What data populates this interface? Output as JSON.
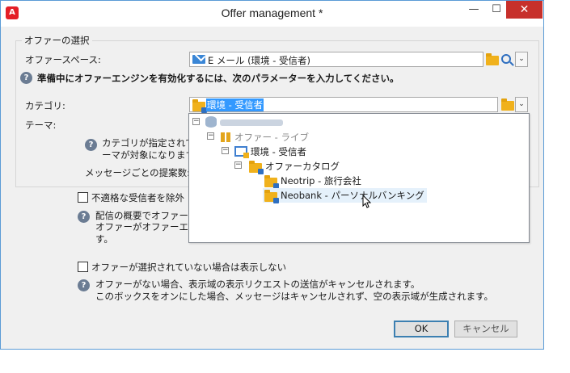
{
  "window": {
    "title": "Offer management *",
    "app_icon_letter": "A",
    "minimize": "—",
    "maximize": "☐",
    "close": "✕"
  },
  "group": {
    "title": "オファーの選択"
  },
  "offer_space": {
    "label": "オファースペース:",
    "value": "E メール (環境 - 受信者)"
  },
  "warning": "準備中にオファーエンジンを有効化するには、次のパラメーターを入力してください。",
  "category": {
    "label": "カテゴリ:",
    "value": "環境 - 受信者"
  },
  "theme": {
    "label": "テーマ:"
  },
  "category_hint": {
    "line1": "カテゴリが指定されて",
    "line2": "ーマが対象になります"
  },
  "proposals": {
    "label": "メッセージごとの提案数:"
  },
  "tree": {
    "offers_live": "オファー - ライブ",
    "env_recipient": "環境 - 受信者",
    "catalog": "オファーカタログ",
    "neotrip": "Neotrip - 旅行会社",
    "neobank": "Neobank - パーソナルバンキング"
  },
  "exclude": {
    "label": "不適格な受信者を除外",
    "hint_line1": "配信の概要でオファーが",
    "hint_line2": "オファーがオファーエンジ",
    "hint_line3": "す。"
  },
  "no_offer": {
    "label": "オファーが選択されていない場合は表示しない",
    "hint_line1": "オファーがない場合、表示域の表示リクエストの送信がキャンセルされます。",
    "hint_line2": "このボックスをオンにした場合、メッセージはキャンセルされず、空の表示域が生成されます。"
  },
  "buttons": {
    "ok": "OK",
    "cancel": "キャンセル"
  },
  "help_glyph": "?",
  "dropdown_glyph": "⌄"
}
